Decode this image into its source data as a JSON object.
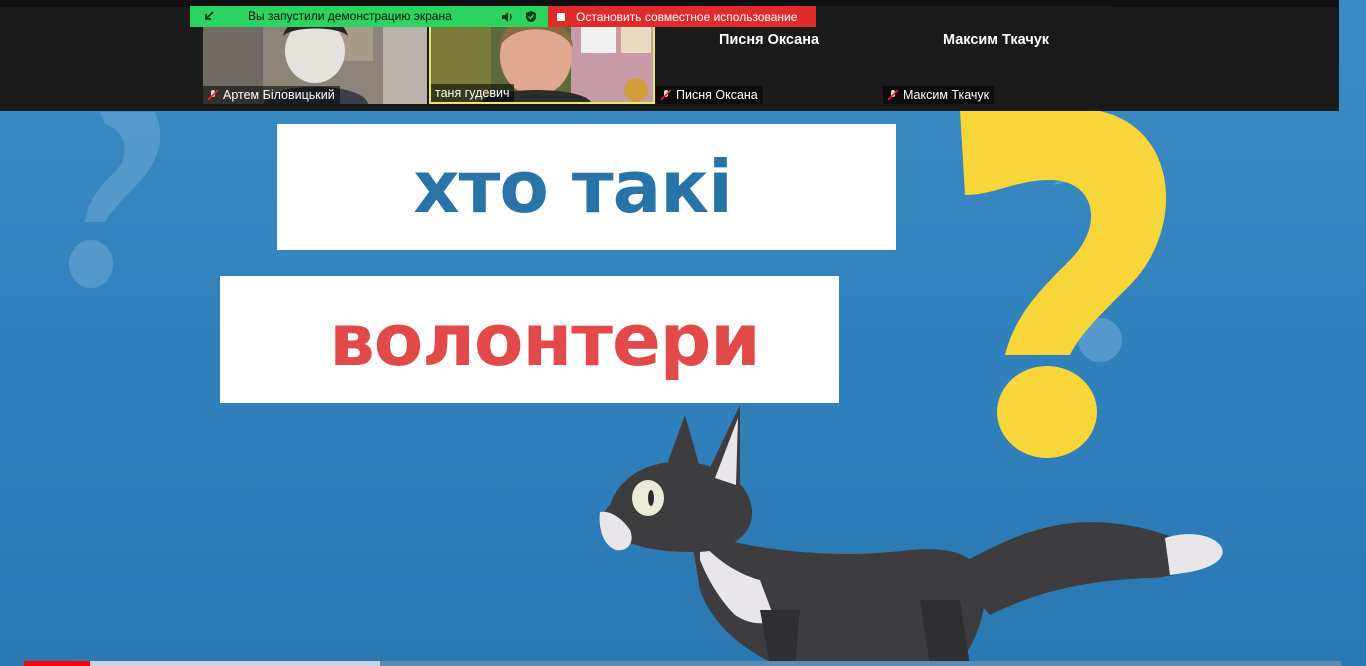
{
  "share_banner": {
    "status_text": "Вы запустили демонстрацию экрана",
    "stop_text": "Остановить совместное использование"
  },
  "participants": [
    {
      "name": "Артем Біловицький",
      "muted": true,
      "video": true
    },
    {
      "name": "таня гудевич",
      "muted": false,
      "video": true,
      "active_speaker": true
    },
    {
      "name": "Писня Оксана",
      "muted": true,
      "video": false
    },
    {
      "name": "Максим Ткачук",
      "muted": true,
      "video": false
    }
  ],
  "slide": {
    "line1": "хто такі",
    "line2": "волонтери",
    "colors": {
      "background": "#2f80bb",
      "line1": "#2873a8",
      "line2": "#e24a4a",
      "question_mark": "#f7d63a"
    }
  },
  "progress": {
    "played_fraction": 0.05,
    "buffered_fraction": 0.27
  }
}
